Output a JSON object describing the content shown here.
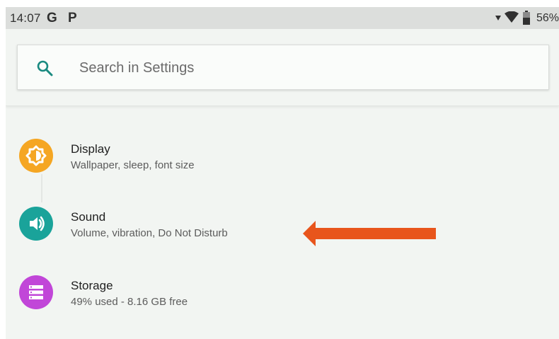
{
  "status_bar": {
    "time": "14:07",
    "notification_icons": [
      "G",
      "P"
    ],
    "battery_percent": "56%",
    "icons": [
      "signal-icon",
      "wifi-icon",
      "battery-icon"
    ]
  },
  "search": {
    "placeholder": "Search in Settings",
    "icon": "search-icon"
  },
  "settings_items": [
    {
      "title": "Display",
      "subtitle": "Wallpaper, sleep, font size",
      "icon": "display-brightness-icon",
      "icon_color": "#f5a623"
    },
    {
      "title": "Sound",
      "subtitle": "Volume, vibration, Do Not Disturb",
      "icon": "volume-icon",
      "icon_color": "#1aa39a"
    },
    {
      "title": "Storage",
      "subtitle": "49% used - 8.16 GB free",
      "icon": "storage-icon",
      "icon_color": "#c146d8"
    }
  ],
  "annotation": {
    "icon": "arrow-left-annotation",
    "color": "#e8551c"
  },
  "colors": {
    "background": "#f2f5f2",
    "status_bar": "#dcdedc",
    "search_icon": "#1a8a80"
  }
}
